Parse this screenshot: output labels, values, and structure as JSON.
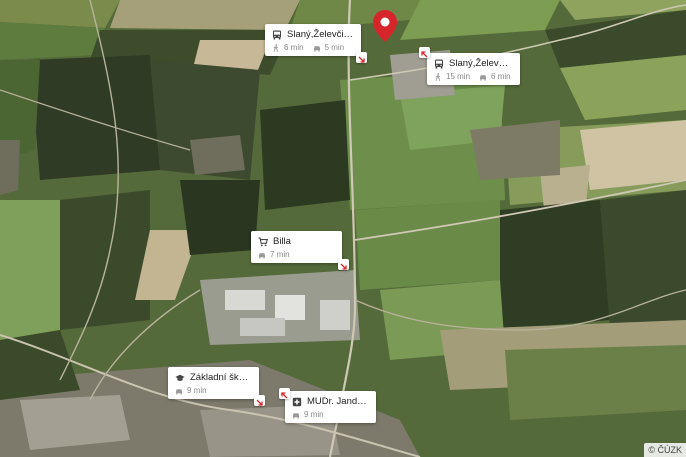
{
  "map": {
    "attribution": "© ČÚZK",
    "pin_icon": "location-pin-icon"
  },
  "pois": [
    {
      "id": "bus-stop-1",
      "icon": "bus-icon",
      "title": "Slaný,Želevčice",
      "walk": "6 min",
      "car": "5 min"
    },
    {
      "id": "bus-stop-2",
      "icon": "bus-icon",
      "title": "Slaný,Želevčice,O...",
      "walk": "15 min",
      "car": "6 min"
    },
    {
      "id": "shop",
      "icon": "shopping-cart-icon",
      "title": "Billa",
      "car": "7 min"
    },
    {
      "id": "school",
      "icon": "graduation-cap-icon",
      "title": "Základní škola Sl...",
      "car": "9 min"
    },
    {
      "id": "doctor",
      "icon": "medical-cross-icon",
      "title": "MUDr. Jandourko...",
      "car": "9 min"
    }
  ],
  "colors": {
    "pin": "#d7262b",
    "card_bg": "#ffffff",
    "card_text": "#222222",
    "card_subtext": "#888888"
  }
}
